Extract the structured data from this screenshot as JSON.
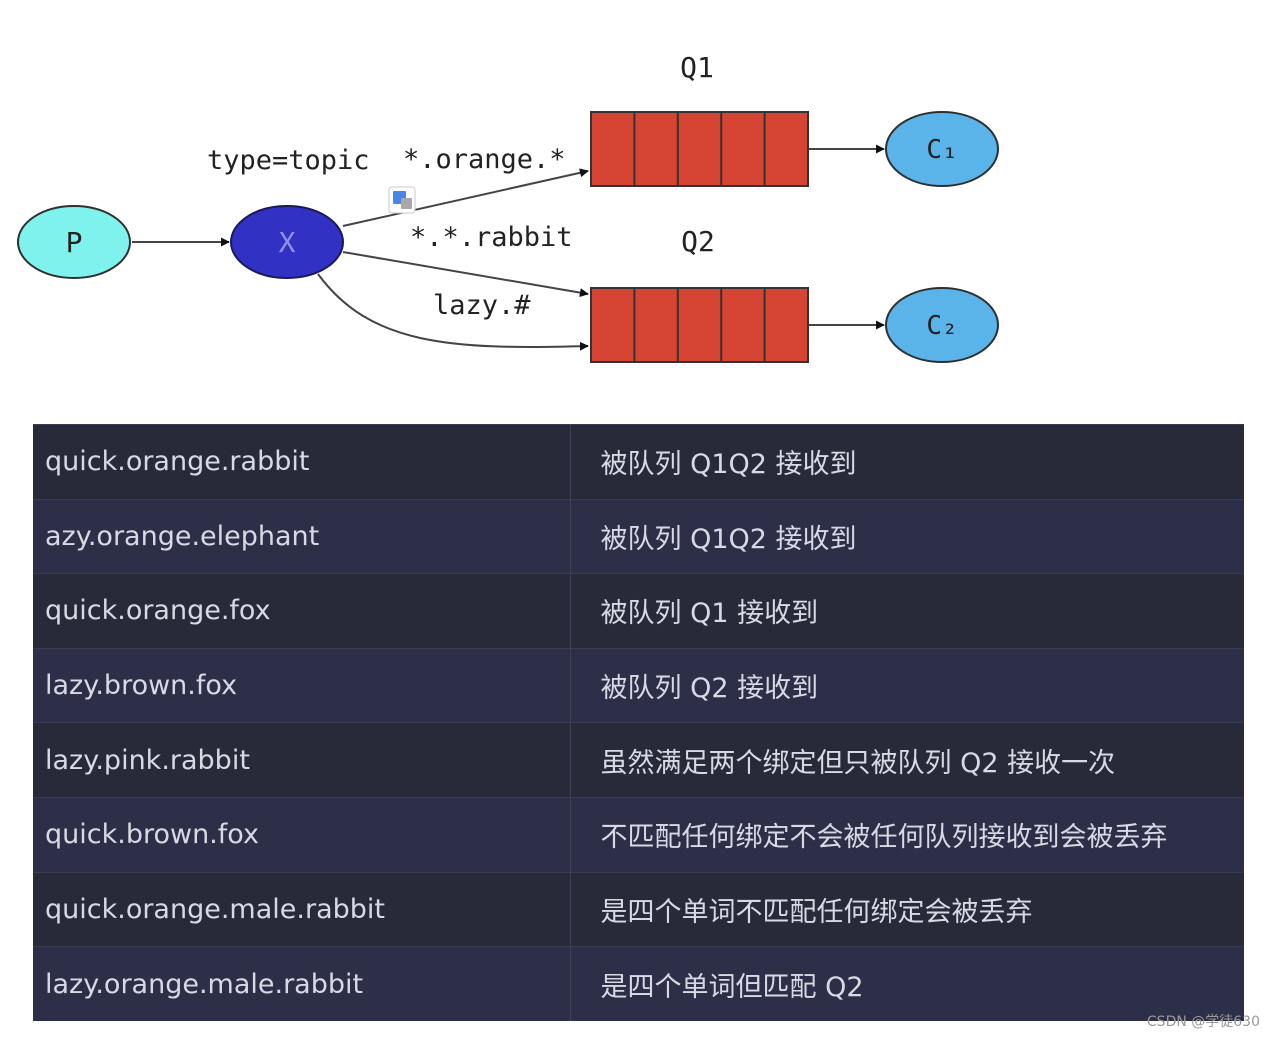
{
  "diagram": {
    "producer": "P",
    "exchange": "X",
    "exchange_type": "type=topic",
    "queue1": "Q1",
    "queue2": "Q2",
    "consumer1": "C₁",
    "consumer2": "C₂",
    "binding_orange": "*.orange.*",
    "binding_rabbit": "*.*.rabbit",
    "binding_lazy": "lazy.#",
    "colors": {
      "producer": "#7ff2ee",
      "exchange": "#3131c4",
      "queue": "#d64533",
      "consumer": "#5ab4ea"
    }
  },
  "table": {
    "rows": [
      {
        "key": "quick.orange.rabbit",
        "result": "被队列 Q1Q2 接收到"
      },
      {
        "key": "azy.orange.elephant",
        "result": "被队列 Q1Q2 接收到"
      },
      {
        "key": "quick.orange.fox",
        "result": "被队列 Q1 接收到"
      },
      {
        "key": "lazy.brown.fox",
        "result": "被队列 Q2 接收到"
      },
      {
        "key": "lazy.pink.rabbit",
        "result": "虽然满足两个绑定但只被队列 Q2 接收一次"
      },
      {
        "key": "quick.brown.fox",
        "result": "不匹配任何绑定不会被任何队列接收到会被丢弃"
      },
      {
        "key": "quick.orange.male.rabbit",
        "result": "是四个单词不匹配任何绑定会被丢弃"
      },
      {
        "key": "lazy.orange.male.rabbit",
        "result": "是四个单词但匹配 Q2"
      }
    ]
  },
  "watermark": "CSDN @学徒630"
}
